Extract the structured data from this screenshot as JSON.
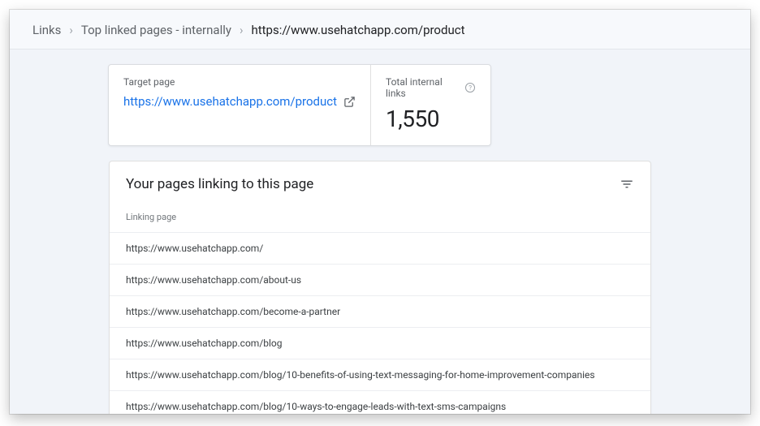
{
  "breadcrumb": {
    "links": "Links",
    "top_linked": "Top linked pages - internally",
    "current": "https://www.usehatchapp.com/product"
  },
  "summary": {
    "target_label": "Target page",
    "target_url": "https://www.usehatchapp.com/product",
    "total_label": "Total internal links",
    "total_value": "1,550"
  },
  "list": {
    "title": "Your pages linking to this page",
    "column_header": "Linking page",
    "rows": [
      "https://www.usehatchapp.com/",
      "https://www.usehatchapp.com/about-us",
      "https://www.usehatchapp.com/become-a-partner",
      "https://www.usehatchapp.com/blog",
      "https://www.usehatchapp.com/blog/10-benefits-of-using-text-messaging-for-home-improvement-companies",
      "https://www.usehatchapp.com/blog/10-ways-to-engage-leads-with-text-sms-campaigns"
    ]
  }
}
